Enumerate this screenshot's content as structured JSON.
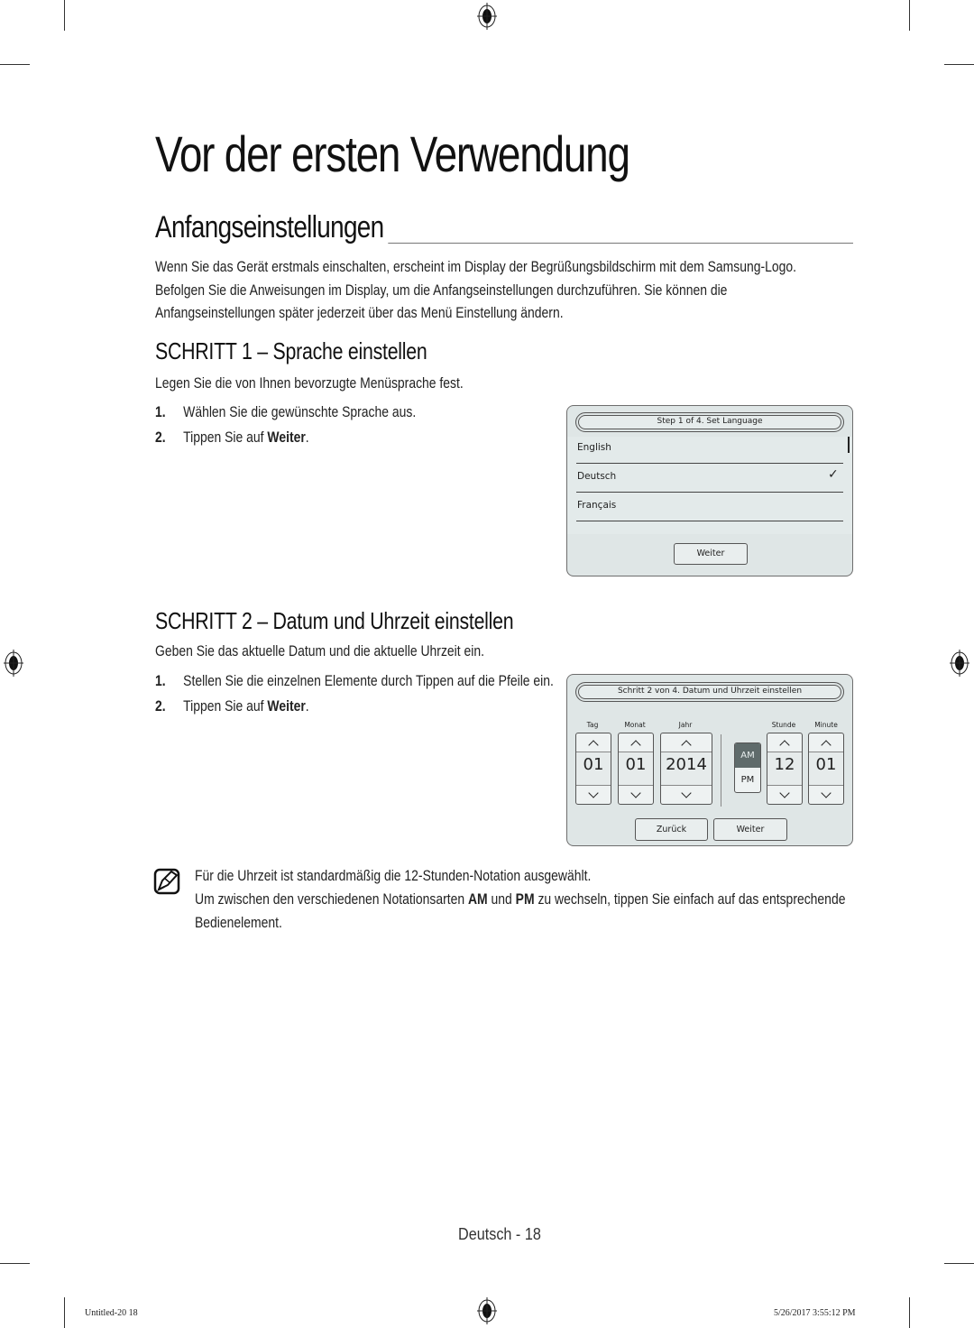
{
  "page": {
    "title": "Vor der ersten Verwendung",
    "section_title": "Anfangseinstellungen",
    "intro": "Wenn Sie das Gerät erstmals einschalten, erscheint im Display der Begrüßungsbildschirm mit dem Samsung-Logo. Befolgen Sie die Anweisungen im Display, um die Anfangseinstellungen durchzuführen. Sie können die Anfangseinstellungen später jederzeit über das Menü Einstellung ändern."
  },
  "step1": {
    "heading": "SCHRITT 1 – Sprache einstellen",
    "lead": "Legen Sie die von Ihnen bevorzugte Menüsprache fest.",
    "items": [
      {
        "num": "1.",
        "text": "Wählen Sie die gewünschte Sprache aus.",
        "bold": ""
      },
      {
        "num": "2.",
        "text": "Tippen Sie auf ",
        "bold": "Weiter",
        "suffix": "."
      }
    ],
    "screen": {
      "title": "Step 1 of 4. Set Language",
      "languages": [
        {
          "label": "English",
          "selected": false
        },
        {
          "label": "Deutsch",
          "selected": true
        },
        {
          "label": "Français",
          "selected": false
        }
      ],
      "checkmark": "✓",
      "next_button": "Weiter"
    }
  },
  "step2": {
    "heading": "SCHRITT 2 – Datum und Uhrzeit einstellen",
    "lead": "Geben Sie das aktuelle Datum und die aktuelle Uhrzeit ein.",
    "items": [
      {
        "num": "1.",
        "text": "Stellen Sie die einzelnen Elemente durch Tippen auf die Pfeile ein.",
        "bold": ""
      },
      {
        "num": "2.",
        "text": "Tippen Sie auf ",
        "bold": "Weiter",
        "suffix": "."
      }
    ],
    "screen": {
      "title": "Schritt 2 von 4. Datum und Uhrzeit einstellen",
      "fields": [
        {
          "label": "Tag",
          "value": "01"
        },
        {
          "label": "Monat",
          "value": "01"
        },
        {
          "label": "Jahr",
          "value": "2014"
        },
        {
          "label": "Stunde",
          "value": "12"
        },
        {
          "label": "Minute",
          "value": "01"
        }
      ],
      "am_label": "AM",
      "pm_label": "PM",
      "selected_period": "AM",
      "back_button": "Zurück",
      "next_button": "Weiter"
    }
  },
  "note": {
    "icon": "note-pencil-icon",
    "line1": "Für die Uhrzeit ist standardmäßig die 12-Stunden-Notation ausgewählt.",
    "line2_pre": "Um zwischen den verschiedenen Notationsarten ",
    "line2_am": "AM",
    "line2_mid": " und ",
    "line2_pm": "PM",
    "line2_post": " zu wechseln, tippen Sie einfach auf das entsprechende",
    "line3": "Bedienelement."
  },
  "footer": {
    "page_label": "Deutsch - 18",
    "slug_left": "Untitled-20   18",
    "slug_right": "5/26/2017   3:55:12 PM"
  },
  "colors": {
    "panel_bg": "#dfe6e6",
    "am_selected_bg": "#5f6b6b"
  }
}
